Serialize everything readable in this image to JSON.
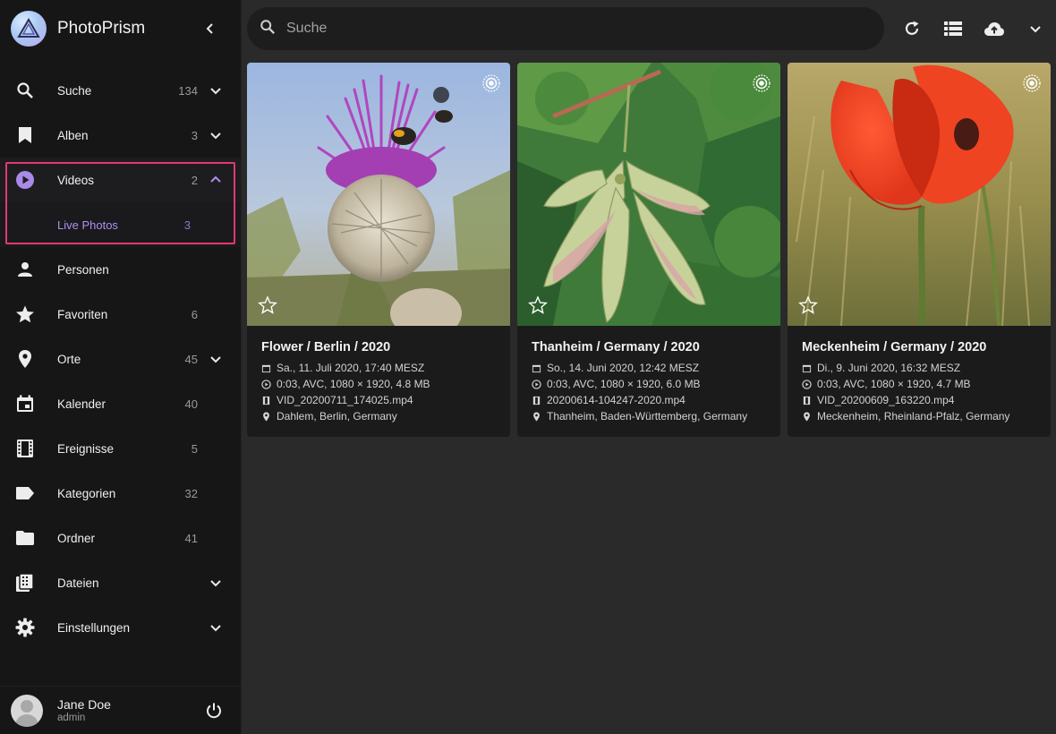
{
  "app": {
    "title": "PhotoPrism"
  },
  "search": {
    "placeholder": "Suche"
  },
  "nav": {
    "items": [
      {
        "label": "Suche",
        "count": "134"
      },
      {
        "label": "Alben",
        "count": "3"
      },
      {
        "label": "Videos",
        "count": "2"
      },
      {
        "label": "Personen",
        "count": ""
      },
      {
        "label": "Favoriten",
        "count": "6"
      },
      {
        "label": "Orte",
        "count": "45"
      },
      {
        "label": "Kalender",
        "count": "40"
      },
      {
        "label": "Ereignisse",
        "count": "5"
      },
      {
        "label": "Kategorien",
        "count": "32"
      },
      {
        "label": "Ordner",
        "count": "41"
      },
      {
        "label": "Dateien",
        "count": ""
      },
      {
        "label": "Einstellungen",
        "count": ""
      }
    ],
    "sub_item": {
      "label": "Live Photos",
      "count": "3"
    }
  },
  "user": {
    "name": "Jane Doe",
    "role": "admin"
  },
  "cards": [
    {
      "title": "Flower / Berlin / 2020",
      "date": "Sa., 11. Juli 2020, 17:40 MESZ",
      "video": "0:03, AVC, 1080 × 1920, 4.8 MB",
      "file": "VID_20200711_174025.mp4",
      "location": "Dahlem, Berlin, Germany"
    },
    {
      "title": "Thanheim / Germany / 2020",
      "date": "So., 14. Juni 2020, 12:42 MESZ",
      "video": "0:03, AVC, 1080 × 1920, 6.0 MB",
      "file": "20200614-104247-2020.mp4",
      "location": "Thanheim, Baden-Württemberg, Germany"
    },
    {
      "title": "Meckenheim / Germany / 2020",
      "date": "Di., 9. Juni 2020, 16:32 MESZ",
      "video": "0:03, AVC, 1080 × 1920, 4.7 MB",
      "file": "VID_20200609_163220.mp4",
      "location": "Meckenheim, Rheinland-Pfalz, Germany"
    }
  ],
  "colors": {
    "accent": "#ae8ff0",
    "highlight": "#e2386f",
    "sidebar": "#161617",
    "background": "#2a2a2b"
  }
}
